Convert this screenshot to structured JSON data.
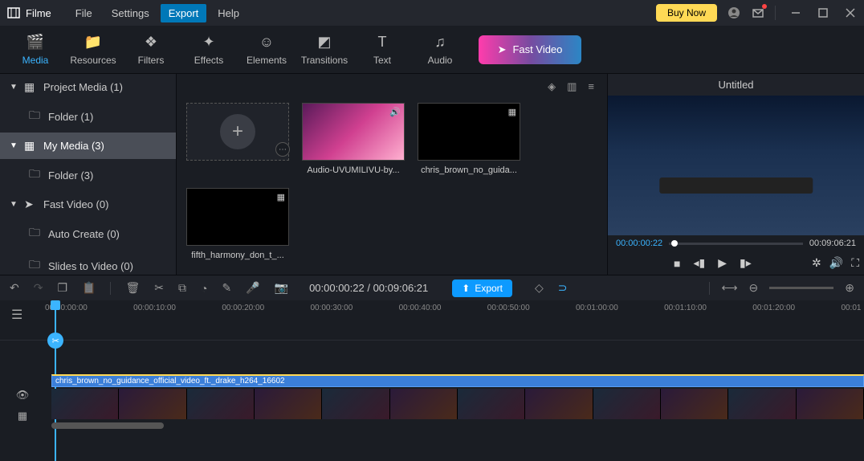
{
  "app": {
    "name": "Filme"
  },
  "menu": {
    "file": "File",
    "settings": "Settings",
    "export": "Export",
    "help": "Help"
  },
  "titlebar": {
    "buy": "Buy Now"
  },
  "toolbar": {
    "media": "Media",
    "resources": "Resources",
    "filters": "Filters",
    "effects": "Effects",
    "elements": "Elements",
    "transitions": "Transitions",
    "text": "Text",
    "audio": "Audio",
    "fast_video": "Fast Video"
  },
  "sidebar": {
    "project_media": "Project Media (1)",
    "project_folder": "Folder (1)",
    "my_media": "My Media (3)",
    "my_folder": "Folder (3)",
    "fast_video": "Fast Video (0)",
    "auto_create": "Auto Create (0)",
    "slides_to_video": "Slides to Video (0)"
  },
  "media": {
    "item1": "Audio-UVUMILIVU-by...",
    "item2": "chris_brown_no_guida...",
    "item3": "fifth_harmony_don_t_..."
  },
  "preview": {
    "title": "Untitled",
    "current": "00:00:00:22",
    "total": "00:09:06:21"
  },
  "editbar": {
    "time": "00:00:00:22 / 00:09:06:21",
    "export": "Export"
  },
  "ruler": {
    "t0": "00:00:00:00",
    "t1": "00:00:10:00",
    "t2": "00:00:20:00",
    "t3": "00:00:30:00",
    "t4": "00:00:40:00",
    "t5": "00:00:50:00",
    "t6": "00:01:00:00",
    "t7": "00:01:10:00",
    "t8": "00:01:20:00",
    "t9": "00:01"
  },
  "clip": {
    "name": "chris_brown_no_guidance_official_video_ft._drake_h264_16602"
  }
}
